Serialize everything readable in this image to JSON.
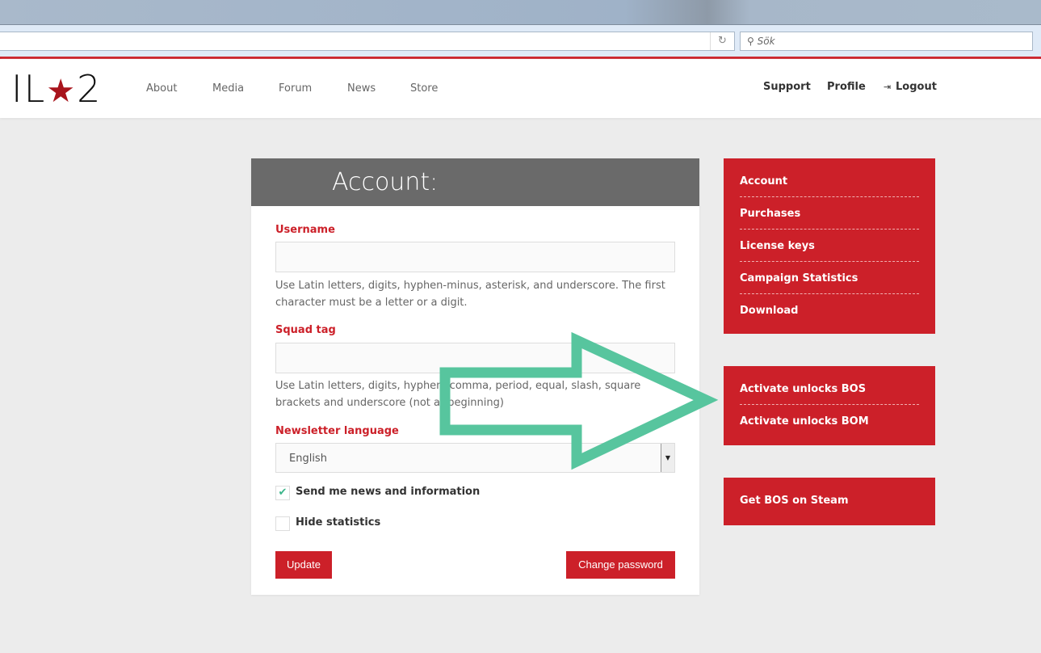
{
  "browser": {
    "search_placeholder": "Sök",
    "reload_icon": "↻"
  },
  "logo": {
    "left": "IL",
    "star": "★",
    "right": "2"
  },
  "nav": {
    "items": [
      "About",
      "Media",
      "Forum",
      "News",
      "Store"
    ],
    "right": [
      "Support",
      "Profile",
      "Logout"
    ]
  },
  "card": {
    "title": "Account:",
    "username_label": "Username",
    "username_value": "",
    "username_help": "Use Latin letters, digits, hyphen-minus, asterisk, and underscore. The first character must be a letter or a digit.",
    "squad_label": "Squad tag",
    "squad_value": "",
    "squad_help": "Use Latin letters, digits, hyphen, comma, period, equal, slash, square brackets and underscore (not at beginning)",
    "newsletter_label": "Newsletter language",
    "newsletter_value": "English",
    "send_news": {
      "label": "Send me news and information",
      "checked": true
    },
    "hide_stats": {
      "label": "Hide statistics",
      "checked": false
    },
    "update": "Update",
    "change_password": "Change password"
  },
  "sidebar": {
    "menu": [
      "Account",
      "Purchases",
      "License keys",
      "Campaign Statistics",
      "Download"
    ],
    "activate": [
      "Activate unlocks BOS",
      "Activate unlocks BOM"
    ],
    "steam": "Get BOS on Steam"
  },
  "colors": {
    "brand": "#cc2029",
    "arrow": "#57c59e"
  }
}
